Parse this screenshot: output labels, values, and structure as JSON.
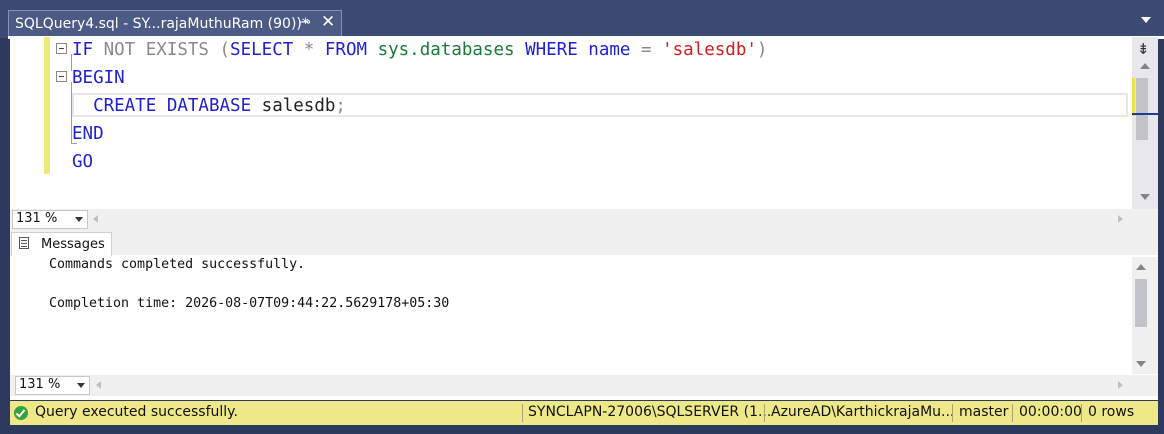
{
  "tab": {
    "title": "SQLQuery4.sql - SY...rajaMuthuRam (90))*",
    "pin_glyph": "⊸",
    "close_glyph": "✕"
  },
  "editor": {
    "lines": [
      {
        "parts": [
          {
            "text": "IF",
            "cls": "kw"
          },
          {
            "text": " NOT EXISTS (",
            "cls": "gray"
          },
          {
            "text": "SELECT",
            "cls": "kw"
          },
          {
            "text": " * ",
            "cls": "gray"
          },
          {
            "text": "FROM",
            "cls": "kw"
          },
          {
            "text": " sys.databases ",
            "cls": "grn"
          },
          {
            "text": "WHERE",
            "cls": "kw"
          },
          {
            "text": " name ",
            "cls": "kw"
          },
          {
            "text": "=",
            "cls": "gray"
          },
          {
            "text": " 'salesdb'",
            "cls": "str"
          },
          {
            "text": ")",
            "cls": "gray"
          }
        ]
      },
      {
        "parts": [
          {
            "text": "BEGIN",
            "cls": "kw"
          }
        ]
      },
      {
        "parts": [
          {
            "text": "  CREATE DATABASE",
            "cls": "kw"
          },
          {
            "text": " salesdb",
            "cls": "blk"
          },
          {
            "text": ";",
            "cls": "gray"
          }
        ]
      },
      {
        "parts": [
          {
            "text": "END",
            "cls": "kw"
          }
        ]
      },
      {
        "parts": [
          {
            "text": "GO",
            "cls": "kw"
          }
        ]
      }
    ],
    "zoom": "131 %"
  },
  "messages": {
    "tab_label": "Messages",
    "line1": "Commands completed successfully.",
    "line2": "Completion time: 2026-08-07T09:44:22.5629178+05:30",
    "zoom": "131 %"
  },
  "status": {
    "message": "Query executed successfully.",
    "server": "SYNCLAPN-27006\\SQLSERVER (1...",
    "user": "AzureAD\\KarthickrajaMu...",
    "database": "master",
    "elapsed": "00:00:00",
    "rows": "0 rows"
  },
  "colors": {
    "frame": "#2d3a5e",
    "status_bg": "#efe889",
    "keyword": "#1f1fd6",
    "string": "#d51c1c",
    "sysobject": "#1a7a3a"
  }
}
